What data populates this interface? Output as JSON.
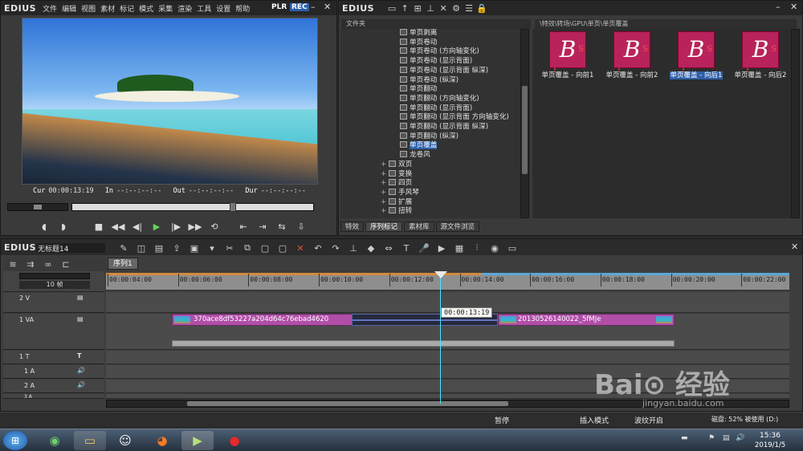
{
  "app": {
    "brand": "EDIUS"
  },
  "player": {
    "menu": [
      "文件",
      "编辑",
      "视图",
      "素材",
      "标记",
      "模式",
      "采集",
      "渲染",
      "工具",
      "设置",
      "帮助"
    ],
    "mode_plr": "PLR",
    "mode_rec": "REC",
    "tc": {
      "cur_label": "Cur",
      "cur": "00:00:13:19",
      "in_label": "In",
      "in": "--:--:--:--",
      "out_label": "Out",
      "out": "--:--:--:--",
      "dur_label": "Dur",
      "dur": "--:--:--:--"
    }
  },
  "bin": {
    "brand": "EDIUS",
    "folder_header": "文件夹",
    "path": "\\特效\\转场\\GPU\\单页\\单页覆盖",
    "tree": [
      {
        "label": "单页剥离",
        "type": "item"
      },
      {
        "label": "单页卷动",
        "type": "item"
      },
      {
        "label": "单页卷动 (方向轴变化)",
        "type": "item"
      },
      {
        "label": "单页卷动 (显示背面)",
        "type": "item"
      },
      {
        "label": "单页卷动 (显示背面 纵深)",
        "type": "item"
      },
      {
        "label": "单页卷动 (纵深)",
        "type": "item"
      },
      {
        "label": "单页翻动",
        "type": "item"
      },
      {
        "label": "单页翻动 (方向轴变化)",
        "type": "item"
      },
      {
        "label": "单页翻动 (显示背面)",
        "type": "item"
      },
      {
        "label": "单页翻动 (显示背面 方向轴变化)",
        "type": "item"
      },
      {
        "label": "单页翻动 (显示背面 纵深)",
        "type": "item"
      },
      {
        "label": "单页翻动 (纵深)",
        "type": "item"
      },
      {
        "label": "单页覆盖",
        "type": "selected"
      },
      {
        "label": "龙卷风",
        "type": "item"
      },
      {
        "label": "双页",
        "type": "folder"
      },
      {
        "label": "变换",
        "type": "folder"
      },
      {
        "label": "四页",
        "type": "folder"
      },
      {
        "label": "手风琴",
        "type": "folder"
      },
      {
        "label": "扩展",
        "type": "folder"
      },
      {
        "label": "扭转",
        "type": "folder"
      }
    ],
    "tabs": [
      "特效",
      "序列标记",
      "素材库",
      "源文件浏览"
    ],
    "thumbs": [
      {
        "label": "单页覆盖 - 向前1",
        "selected": false
      },
      {
        "label": "单页覆盖 - 向前2",
        "selected": false
      },
      {
        "label": "单页覆盖 - 向后1",
        "selected": true
      },
      {
        "label": "单页覆盖 - 向后2",
        "selected": false
      }
    ]
  },
  "timeline": {
    "brand": "EDIUS",
    "project_name": "无标题14",
    "sequence_tab": "序列1",
    "frame_count": "10 帧",
    "ruler": [
      "00:00:04:00",
      "00:00:06:00",
      "00:00:08:00",
      "00:00:10:00",
      "00:00:12:00",
      "00:00:14:00",
      "00:00:16:00",
      "00:00:18:00",
      "00:00:20:00",
      "00:00:22:00"
    ],
    "tooltip": "00:00:13:19",
    "tracks": [
      {
        "label": "2 V"
      },
      {
        "label": "1 VA"
      },
      {
        "label": "1 T"
      },
      {
        "label": "1 A"
      },
      {
        "label": "2 A"
      },
      {
        "label": "3 A"
      }
    ],
    "clips": [
      {
        "name": "370ace8df53227a204d64c76ebad4620"
      },
      {
        "name": "20130526140022_5fMJe"
      }
    ]
  },
  "statusbar": {
    "stop": "暂停",
    "insert_mode": "插入模式",
    "ripple": "波纹开启",
    "disk": "磁盘: 52% 被使用 (D:)"
  },
  "taskbar": {
    "time": "15:36",
    "date": "2019/1/5"
  },
  "watermark": {
    "site": "jingyan.baidu.com"
  },
  "colors": {
    "accent": "#2d5fa8",
    "clip": "#b04ea8",
    "playhead": "#4ae4ff"
  }
}
